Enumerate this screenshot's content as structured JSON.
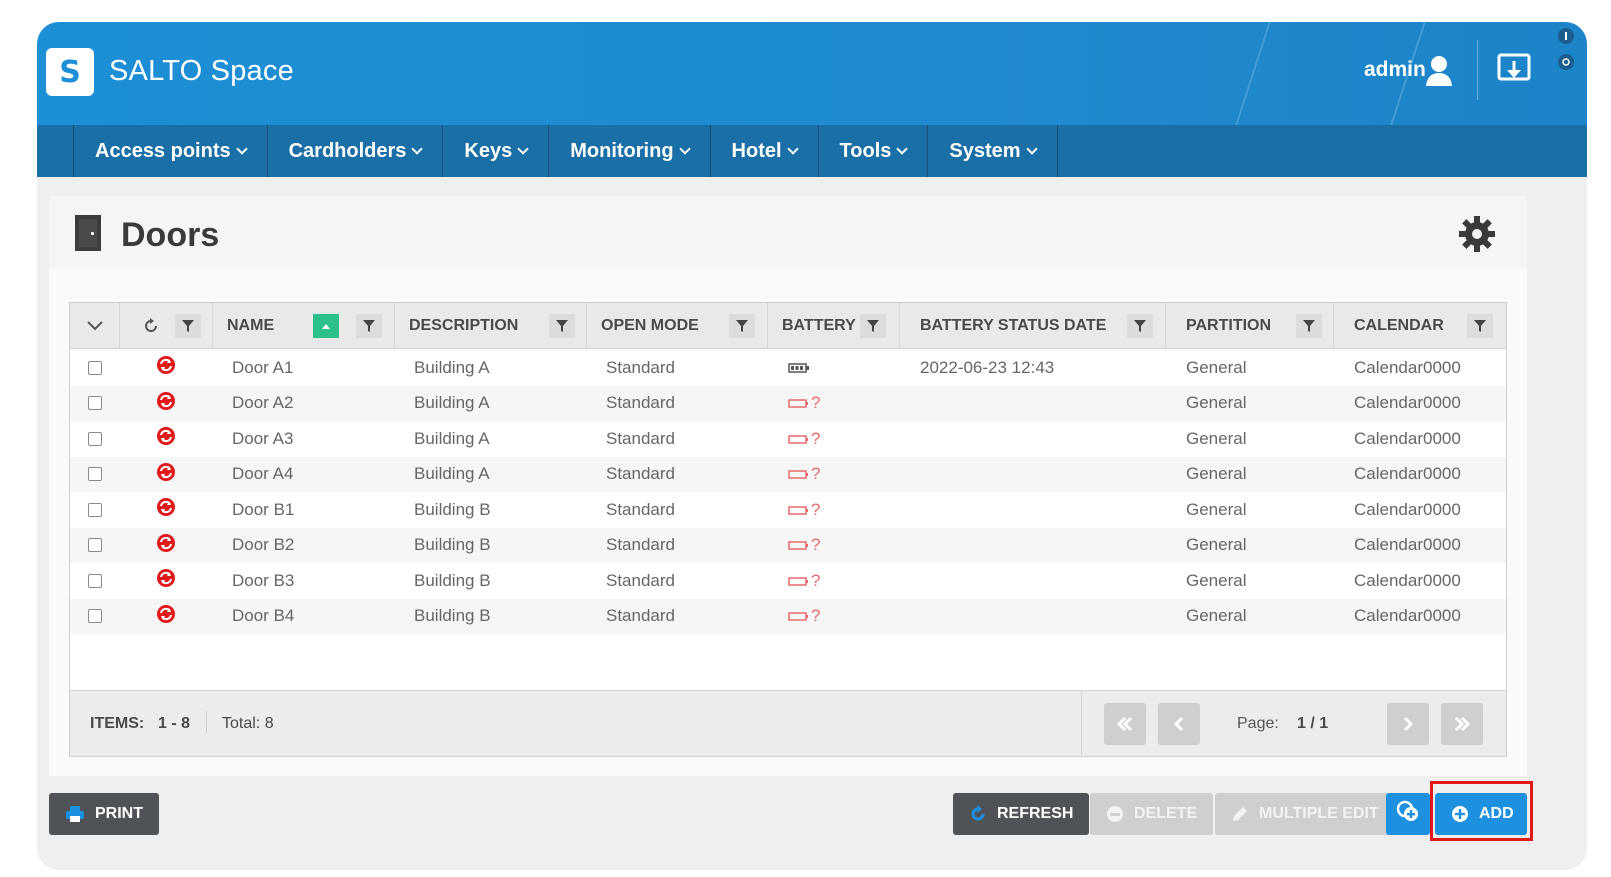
{
  "app": {
    "title": "SALTO Space",
    "logo_letter": "S",
    "user": "admin"
  },
  "nav": {
    "items": [
      {
        "label": "Access points"
      },
      {
        "label": "Cardholders"
      },
      {
        "label": "Keys"
      },
      {
        "label": "Monitoring"
      },
      {
        "label": "Hotel"
      },
      {
        "label": "Tools"
      },
      {
        "label": "System"
      }
    ]
  },
  "page": {
    "title": "Doors"
  },
  "table": {
    "columns": {
      "name": "NAME",
      "description": "DESCRIPTION",
      "open_mode": "OPEN MODE",
      "battery": "BATTERY",
      "battery_status_date": "BATTERY STATUS DATE",
      "partition": "PARTITION",
      "calendar": "CALENDAR"
    },
    "rows": [
      {
        "name": "Door A1",
        "description": "Building A",
        "open_mode": "Standard",
        "battery": "ok",
        "battery_status_date": "2022-06-23 12:43",
        "partition": "General",
        "calendar": "Calendar0000"
      },
      {
        "name": "Door A2",
        "description": "Building A",
        "open_mode": "Standard",
        "battery": "unknown",
        "battery_status_date": "",
        "partition": "General",
        "calendar": "Calendar0000"
      },
      {
        "name": "Door A3",
        "description": "Building A",
        "open_mode": "Standard",
        "battery": "unknown",
        "battery_status_date": "",
        "partition": "General",
        "calendar": "Calendar0000"
      },
      {
        "name": "Door A4",
        "description": "Building A",
        "open_mode": "Standard",
        "battery": "unknown",
        "battery_status_date": "",
        "partition": "General",
        "calendar": "Calendar0000"
      },
      {
        "name": "Door B1",
        "description": "Building B",
        "open_mode": "Standard",
        "battery": "unknown",
        "battery_status_date": "",
        "partition": "General",
        "calendar": "Calendar0000"
      },
      {
        "name": "Door B2",
        "description": "Building B",
        "open_mode": "Standard",
        "battery": "unknown",
        "battery_status_date": "",
        "partition": "General",
        "calendar": "Calendar0000"
      },
      {
        "name": "Door B3",
        "description": "Building B",
        "open_mode": "Standard",
        "battery": "unknown",
        "battery_status_date": "",
        "partition": "General",
        "calendar": "Calendar0000"
      },
      {
        "name": "Door B4",
        "description": "Building B",
        "open_mode": "Standard",
        "battery": "unknown",
        "battery_status_date": "",
        "partition": "General",
        "calendar": "Calendar0000"
      }
    ],
    "battery_unknown_mark": "?"
  },
  "footer": {
    "items_label": "ITEMS:",
    "items_range": "1 - 8",
    "total_label": "Total: 8",
    "page_label": "Page:",
    "page_value": "1 / 1"
  },
  "actions": {
    "print": "PRINT",
    "refresh": "REFRESH",
    "delete": "DELETE",
    "multiple_edit": "MULTIPLE EDIT",
    "add": "ADD"
  },
  "colors": {
    "header_blue": "#1d8fd6",
    "nav_blue": "#1a6fa6",
    "sort_green": "#2bbf8a",
    "status_red": "#e0191b",
    "add_blue": "#1e90e0",
    "dark_button": "#4f5357"
  },
  "icons": {
    "user": "user-icon",
    "download": "download-icon",
    "door": "door-icon",
    "gear": "gear-icon",
    "filter": "filter-icon",
    "sync_status": "sync-error-icon",
    "battery": "battery-icon"
  }
}
